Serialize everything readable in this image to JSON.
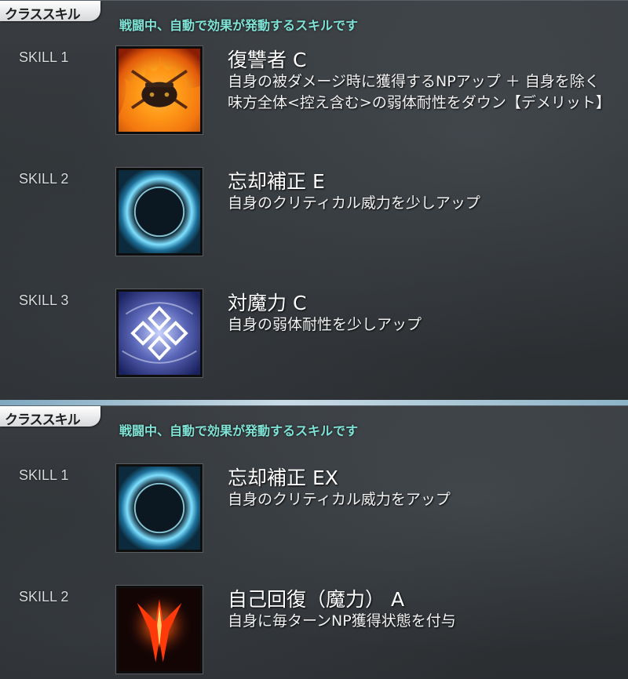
{
  "panels": [
    {
      "tab_label": "クラススキル",
      "subtitle": "戦闘中、自動で効果が発動するスキルです",
      "skills": [
        {
          "label": "SKILL 1",
          "name": "復讐者 C",
          "desc": "自身の被ダメージ時に獲得するNPアップ ＋ 自身を除く味方全体<控え含む>の弱体耐性をダウン【デメリット】",
          "icon": "avenger-skill-icon"
        },
        {
          "label": "SKILL 2",
          "name": "忘却補正 E",
          "desc": "自身のクリティカル威力を少しアップ",
          "icon": "eclipse-orb-icon"
        },
        {
          "label": "SKILL 3",
          "name": "対魔力 C",
          "desc": "自身の弱体耐性を少しアップ",
          "icon": "magic-resistance-icon"
        }
      ]
    },
    {
      "tab_label": "クラススキル",
      "subtitle": "戦闘中、自動で効果が発動するスキルです",
      "skills": [
        {
          "label": "SKILL 1",
          "name": "忘却補正 EX",
          "desc": "自身のクリティカル威力をアップ",
          "icon": "eclipse-orb-icon"
        },
        {
          "label": "SKILL 2",
          "name": "自己回復（魔力） A",
          "desc": "自身に毎ターンNP獲得状態を付与",
          "icon": "flame-wings-icon"
        }
      ]
    }
  ]
}
